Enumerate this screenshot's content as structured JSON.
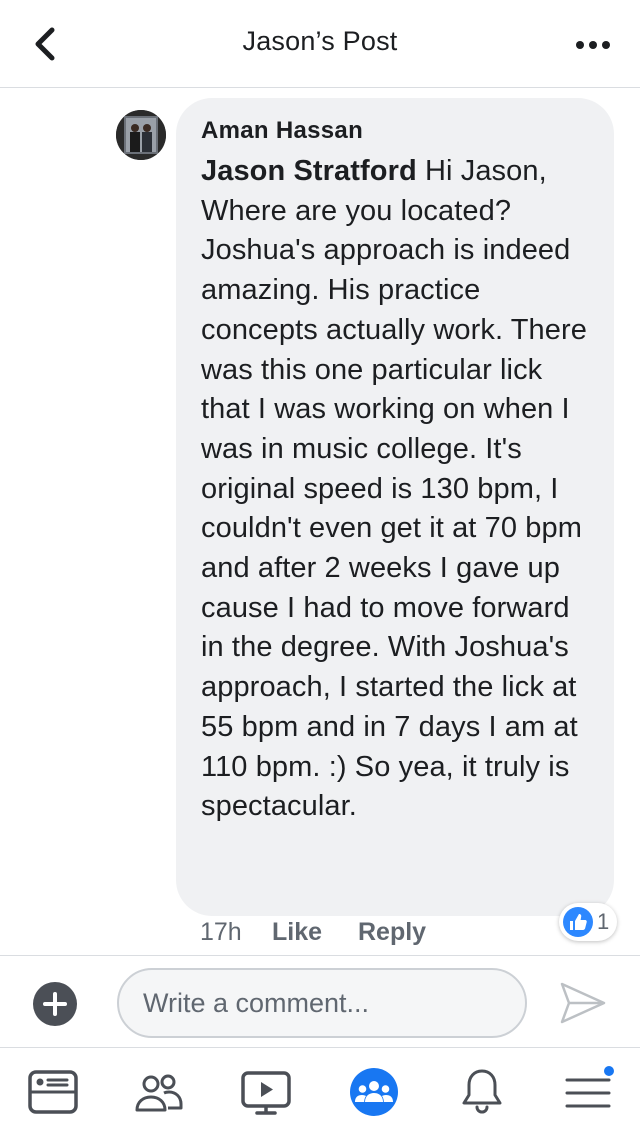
{
  "header": {
    "title": "Jason’s Post"
  },
  "comment": {
    "author": "Aman Hassan",
    "mention": "Jason Stratford",
    "text": " Hi Jason, Where are you located? Joshua's approach is indeed amazing. His practice concepts actually work. There was this one particular lick that I was working on when I was in music college. It's original speed is 130 bpm, I couldn't even get it at 70 bpm and after 2 weeks I gave up cause I had to move forward in the degree. With Joshua's approach, I started the lick at 55 bpm and in 7 days I am at 110 bpm. :) So yea, it truly is spectacular.",
    "time": "17h",
    "like_label": "Like",
    "reply_label": "Reply",
    "reaction_count": "1"
  },
  "composer": {
    "placeholder": "Write a comment..."
  },
  "bottom_nav": {
    "items": [
      "news-feed",
      "friends",
      "watch",
      "groups",
      "notifications",
      "menu"
    ],
    "active": "groups",
    "notification_badge": true
  },
  "colors": {
    "accent": "#1877f2",
    "bubble": "#f0f1f3",
    "secondary_text": "#606770",
    "icon_gray": "#4b4f56"
  }
}
